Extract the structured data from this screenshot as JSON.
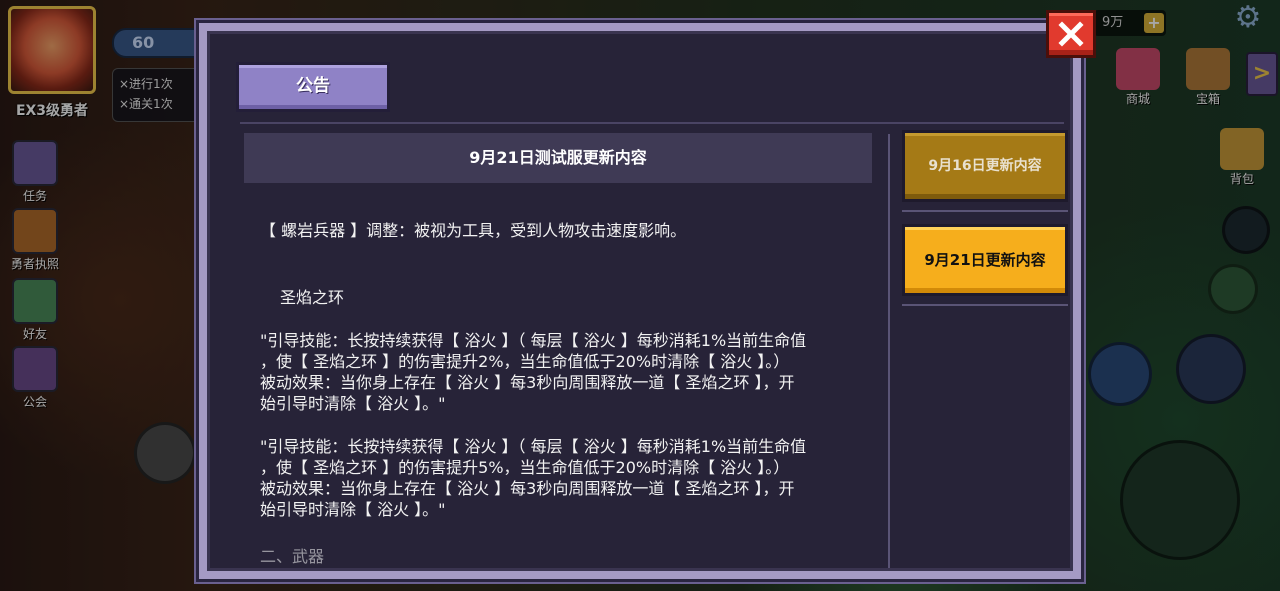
{
  "hud": {
    "rank_label": "EX3级勇者",
    "energy_value": "60",
    "quest_lines": [
      "×进行1次",
      "×通关1次"
    ],
    "side_buttons": [
      {
        "label": "任务",
        "icon": "scroll-icon",
        "color": "#6a5a9a"
      },
      {
        "label": "勇者执照",
        "icon": "badge-icon",
        "color": "#b06a2a"
      },
      {
        "label": "好友",
        "icon": "mushroom-icon",
        "color": "#4a8a5a"
      },
      {
        "label": "公会",
        "icon": "shield-icon",
        "color": "#6a4a8a"
      }
    ],
    "gold_value": "9万",
    "gold_plus": "+",
    "settings_icon": "gear-icon",
    "right_items": [
      {
        "label": "商城",
        "icon": "shop-icon",
        "color": "#c84a6a"
      },
      {
        "label": "宝箱",
        "icon": "chest-icon",
        "color": "#b07a3a"
      },
      {
        "label": "背包",
        "icon": "backpack-icon",
        "color": "#c89a3a"
      }
    ],
    "expand_label": ">"
  },
  "dialog": {
    "tab_label": "公告",
    "close_icon": "close-icon",
    "content_title": "9月21日测试服更新内容",
    "body": {
      "line1": "【 螺岩兵器 】调整：被视为工具，受到人物攻击速度影响。",
      "section_title": "圣焰之环",
      "para1_l1": "\"引导技能：长按持续获得【 浴火 】（ 每层【 浴火 】每秒消耗1%当前生命值",
      "para1_l2": "，使【 圣焰之环 】的伤害提升2%，当生命值低于20%时清除【 浴火 】。）",
      "para1_l3": "被动效果：当你身上存在【 浴火 】每3秒向周围释放一道【 圣焰之环 】，开",
      "para1_l4": "始引导时清除【 浴火 】。\"",
      "para2_l1": "\"引导技能：长按持续获得【 浴火 】（ 每层【 浴火 】每秒消耗1%当前生命值",
      "para2_l2": "，使【 圣焰之环 】的伤害提升5%，当生命值低于20%时清除【 浴火 】。）",
      "para2_l3": "被动效果：当你身上存在【 浴火 】每3秒向周围释放一道【 圣焰之环 】，开",
      "para2_l4": "始引导时清除【 浴火 】。\"",
      "cut_line": "二、武器"
    },
    "versions": [
      {
        "label": "9月16日更新内容",
        "active": false
      },
      {
        "label": "9月21日更新内容",
        "active": true
      }
    ]
  },
  "colors": {
    "panel_bg": "#272338",
    "frame": "#a59ac4",
    "tab": "#8f82c6",
    "active_version": "#f6ae1c",
    "inactive_version": "#a57a16",
    "close": "#e13a2e"
  }
}
